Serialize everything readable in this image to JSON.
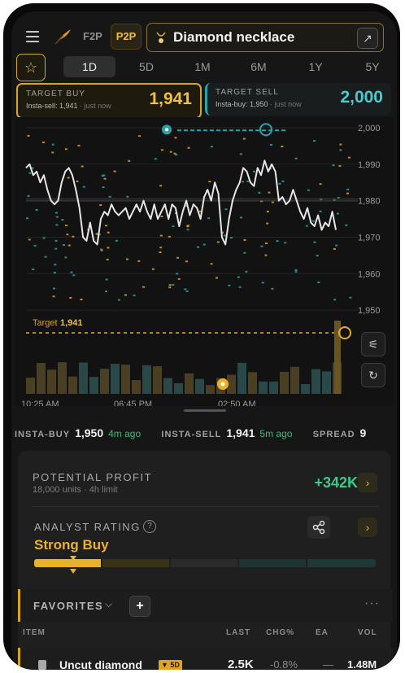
{
  "header": {
    "tabs": [
      {
        "label": "F2P",
        "active": false
      },
      {
        "label": "P2P",
        "active": true
      }
    ],
    "search": {
      "value": "Diamond necklace"
    }
  },
  "timeframes": [
    "1D",
    "5D",
    "1M",
    "6M",
    "1Y",
    "5Y"
  ],
  "active_timeframe": "1D",
  "target_buy": {
    "label": "TARGET BUY",
    "sub": "Insta-sell: 1,941",
    "ago": "· just now",
    "value": "1,941"
  },
  "target_sell": {
    "label": "TARGET SELL",
    "sub": "Insta-buy: 1,950",
    "ago": "· just now",
    "value": "2,000"
  },
  "chart": {
    "y_ticks": [
      "2,000",
      "1,990",
      "1,980",
      "1,970",
      "1,960",
      "1,950"
    ],
    "x_ticks": [
      "10:25 AM",
      "06:45 PM",
      "02:50 AM"
    ],
    "target_label": "Target",
    "target_value": "1,941"
  },
  "chart_data": {
    "type": "line",
    "x_ticks": [
      "10:25 AM",
      "06:45 PM",
      "02:50 AM"
    ],
    "ylim": [
      1946,
      2002
    ],
    "y_ticks": [
      2000,
      1990,
      1980,
      1970,
      1960,
      1950
    ],
    "target": 1941,
    "series": [
      {
        "values": [
          1989,
          1990,
          1987,
          1988,
          1985,
          1987,
          1983,
          1980,
          1979,
          1980,
          1985,
          1988,
          1989,
          1987,
          1983,
          1978,
          1970,
          1969,
          1974,
          1969,
          1968,
          1975,
          1977,
          1976,
          1979,
          1977,
          1976,
          1977,
          1978,
          1975,
          1977,
          1979,
          1977,
          1980,
          1977,
          1975,
          1979,
          1975,
          1977,
          1979,
          1975,
          1979,
          1978,
          1973,
          1977,
          1980,
          1976,
          1979,
          1978,
          1975,
          1981,
          1983,
          1980,
          1985,
          1982,
          1970,
          1968,
          1975,
          1980,
          1983,
          1985,
          1989,
          1988,
          1985,
          1984,
          1989,
          1987,
          1991,
          1988,
          1990,
          1988,
          1980,
          1981,
          1979,
          1980,
          1983,
          1980,
          1977,
          1975,
          1978,
          1974,
          1973,
          1976,
          1972,
          1974,
          1973,
          1977,
          1972
        ]
      }
    ]
  },
  "ticker": [
    {
      "label": "INSTA-BUY",
      "value": "1,950",
      "ago": "4m ago"
    },
    {
      "label": "INSTA-SELL",
      "value": "1,941",
      "ago": "5m ago"
    },
    {
      "label": "SPREAD",
      "value": "9",
      "ago": ""
    }
  ],
  "profit": {
    "title": "POTENTIAL PROFIT",
    "sub": "18,000 units · 4h limit",
    "value": "+342K"
  },
  "rating": {
    "title": "ANALYST RATING",
    "value": "Strong Buy",
    "level": 0.12
  },
  "favorites": {
    "title": "FAVORITES",
    "columns": [
      "ITEM",
      "LAST",
      "CHG%",
      "EA",
      "VOL"
    ],
    "rows": [
      {
        "name": "Uncut diamond",
        "badge": "▼ 5D",
        "last": "2.5K",
        "chg": "-0.8%",
        "ea": "—",
        "vol": "1.48M"
      }
    ]
  },
  "colors": {
    "accent": "#e8b32a",
    "teal": "#2aa3a8",
    "positive": "#3dc98a"
  }
}
